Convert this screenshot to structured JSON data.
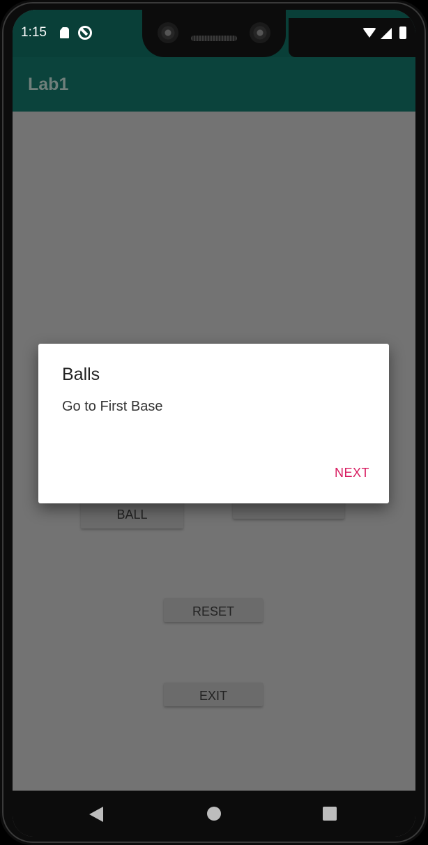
{
  "status_bar": {
    "time": "1:15",
    "icons": [
      "sd-card-icon",
      "sync-icon",
      "wifi-icon",
      "signal-icon",
      "battery-icon"
    ]
  },
  "app_bar": {
    "title": "Lab1"
  },
  "buttons": {
    "ball": "BALL",
    "reset": "RESET",
    "exit": "EXIT"
  },
  "dialog": {
    "title": "Balls",
    "message": "Go to First Base",
    "positive_label": "NEXT"
  },
  "colors": {
    "status_bar": "#093f38",
    "app_bar": "#0b433c",
    "accent": "#d81b60",
    "scrim_background": "#737373"
  },
  "nav_bar": {
    "icons": [
      "back-icon",
      "home-icon",
      "recents-icon"
    ]
  }
}
